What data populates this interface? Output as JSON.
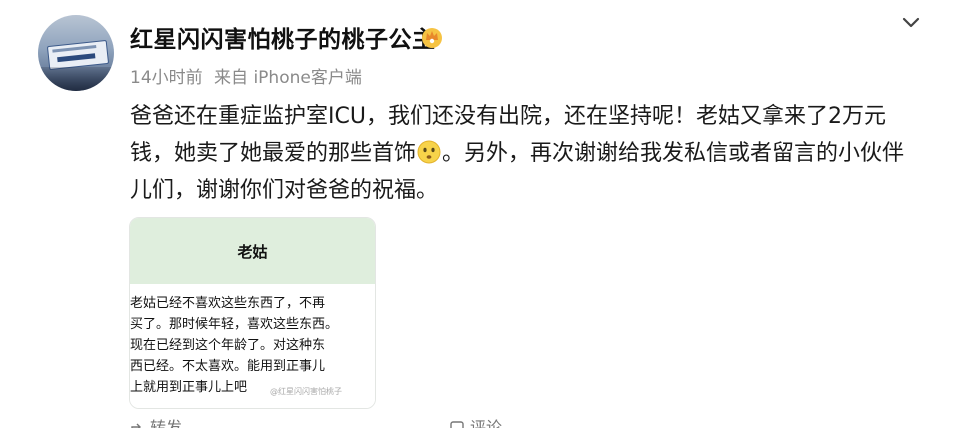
{
  "post": {
    "author": "红星闪闪害怕桃子的桃子公主",
    "time": "14小时前",
    "source": "来自 iPhone客户端",
    "text_part1": "爸爸还在重症监护室ICU，我们还没有出院，还在坚持呢！老姑又拿来了2万元钱，她卖了她最爱的那些首饰",
    "text_part2": "。另外，再次谢谢给我发私信或者留言的小伙伴儿们，谢谢你们对爸爸的祝福。",
    "emoji": "sad-face-emoji"
  },
  "image": {
    "chat_title": "老姑",
    "message_lines": [
      "老姑已经不喜欢这些东西了，不再",
      "买了。那时候年轻，喜欢这些东西。",
      "现在已经到这个年龄了。对这种东",
      "西已经。不太喜欢。能用到正事儿",
      "上就用到正事儿上吧"
    ],
    "watermark": "@红星闪闪害怕桃子"
  },
  "actions": {
    "share_label": "转发",
    "comment_label": "评论"
  },
  "icons": {
    "more": "chevron-down-icon",
    "badge": "crown-badge-icon",
    "share": "share-icon",
    "comment": "comment-icon"
  },
  "colors": {
    "header_green": "#dfeedd",
    "meta_gray": "#8a8a8a",
    "badge_orange": "#f2a33a"
  }
}
